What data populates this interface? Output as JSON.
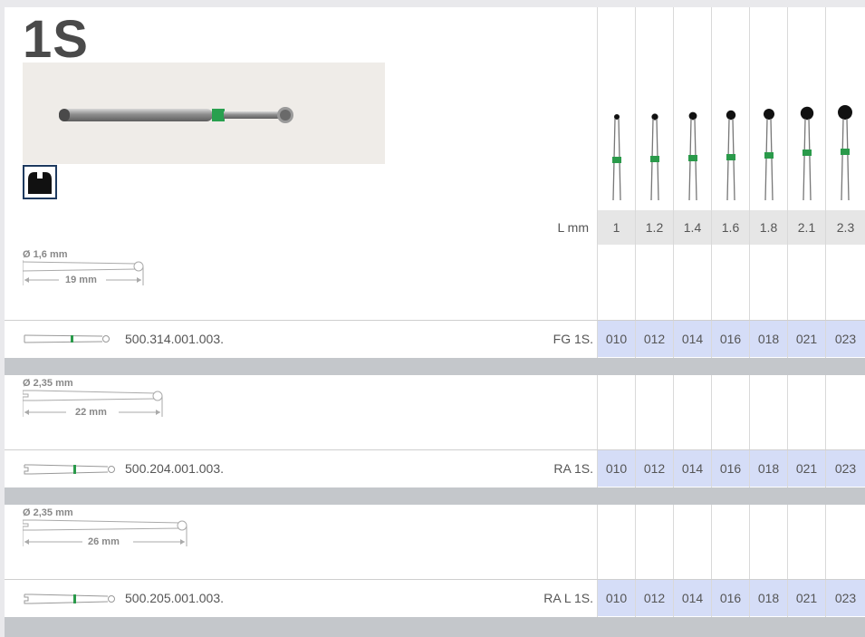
{
  "header": {
    "title": "1S"
  },
  "shape_icon": "round-bur-shape-icon",
  "colors": {
    "band": "#2a9a4a",
    "code_cell": "#d5ddf7",
    "lmm_cell": "#e6e6e6",
    "separator": "#c4c7cb"
  },
  "size_table": {
    "lmm_label": "L mm",
    "lengths": [
      "1",
      "1.2",
      "1.4",
      "1.6",
      "1.8",
      "2.1",
      "2.3"
    ]
  },
  "products": [
    {
      "diameter": "Ø 1,6 mm",
      "length": "19 mm",
      "sku": "500.314.001.003.",
      "family": "FG 1S.",
      "codes": [
        "010",
        "012",
        "014",
        "016",
        "018",
        "021",
        "023"
      ]
    },
    {
      "diameter": "Ø 2,35 mm",
      "length": "22 mm",
      "sku": "500.204.001.003.",
      "family": "RA 1S.",
      "codes": [
        "010",
        "012",
        "014",
        "016",
        "018",
        "021",
        "023"
      ]
    },
    {
      "diameter": "Ø 2,35 mm",
      "length": "26 mm",
      "sku": "500.205.001.003.",
      "family": "RA L 1S.",
      "codes": [
        "010",
        "012",
        "014",
        "016",
        "018",
        "021",
        "023"
      ]
    }
  ]
}
